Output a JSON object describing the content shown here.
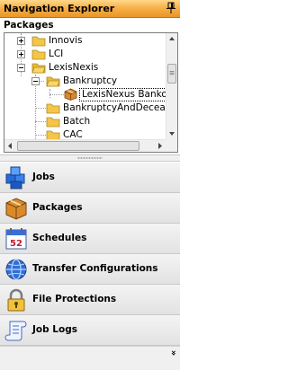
{
  "titlebar": {
    "title": "Navigation Explorer",
    "pin_icon": "pin-icon"
  },
  "packages_header": "Packages",
  "tree": {
    "nodes": [
      {
        "label": "Innovis",
        "level": 0,
        "expander": "plus"
      },
      {
        "label": "LCI",
        "level": 0,
        "expander": "plus"
      },
      {
        "label": "LexisNexis",
        "level": 0,
        "expander": "minus"
      },
      {
        "label": "Bankruptcy",
        "level": 1,
        "expander": "minus"
      },
      {
        "label": "LexisNexus Banko",
        "level": 2,
        "expander": "none",
        "selected": true,
        "icon": "package-icon"
      },
      {
        "label": "BankruptcyAndDeceas",
        "level": 1,
        "expander": "none"
      },
      {
        "label": "Batch",
        "level": 1,
        "expander": "none"
      },
      {
        "label": "CAC",
        "level": 1,
        "expander": "none"
      }
    ]
  },
  "nav": {
    "items": [
      {
        "label": "Jobs",
        "icon": "jobs-icon"
      },
      {
        "label": "Packages",
        "icon": "packages-icon"
      },
      {
        "label": "Schedules",
        "icon": "calendar-icon"
      },
      {
        "label": "Transfer Configurations",
        "icon": "globe-icon"
      },
      {
        "label": "File Protections",
        "icon": "lock-icon"
      },
      {
        "label": "Job Logs",
        "icon": "scroll-icon"
      }
    ]
  },
  "calendar_day": "52",
  "footer": {
    "chevron": "»"
  },
  "colors": {
    "title_bar": "#f7b14a",
    "folder": "#f3c64a"
  }
}
